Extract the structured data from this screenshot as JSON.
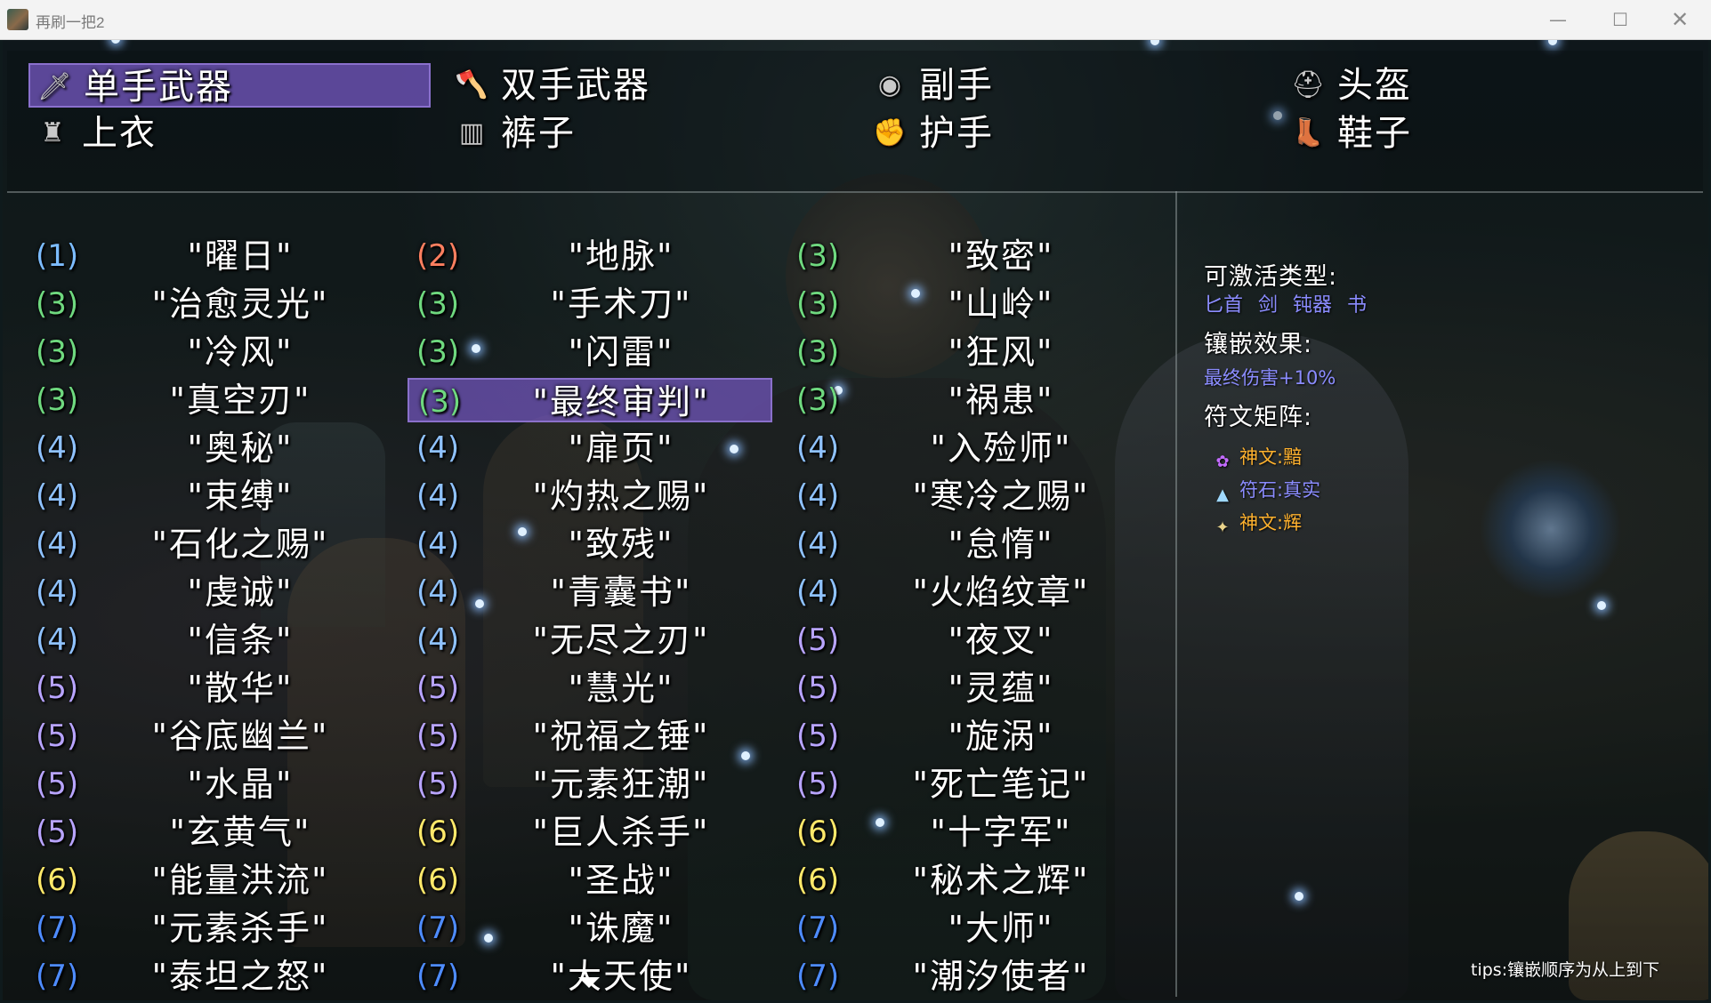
{
  "window": {
    "title": "再刷一把2",
    "minimize": "—",
    "maximize": "☐",
    "close": "✕"
  },
  "tabs": [
    {
      "label": "单手武器",
      "icon": "sword-icon",
      "selected": true
    },
    {
      "label": "双手武器",
      "icon": "axe-icon",
      "selected": false
    },
    {
      "label": "副手",
      "icon": "shield-icon",
      "selected": false
    },
    {
      "label": "头盔",
      "icon": "helmet-icon",
      "selected": false
    },
    {
      "label": "上衣",
      "icon": "armor-icon",
      "selected": false
    },
    {
      "label": "裤子",
      "icon": "pants-icon",
      "selected": false
    },
    {
      "label": "护手",
      "icon": "gauntlet-icon",
      "selected": false
    },
    {
      "label": "鞋子",
      "icon": "boots-icon",
      "selected": false
    }
  ],
  "runewords": [
    [
      {
        "level": "(1)",
        "name": "\"曜日\""
      },
      {
        "level": "(3)",
        "name": "\"治愈灵光\""
      },
      {
        "level": "(3)",
        "name": "\"冷风\""
      },
      {
        "level": "(3)",
        "name": "\"真空刃\""
      },
      {
        "level": "(4)",
        "name": "\"奥秘\""
      },
      {
        "level": "(4)",
        "name": "\"束缚\""
      },
      {
        "level": "(4)",
        "name": "\"石化之赐\""
      },
      {
        "level": "(4)",
        "name": "\"虔诚\""
      },
      {
        "level": "(4)",
        "name": "\"信条\""
      },
      {
        "level": "(5)",
        "name": "\"散华\""
      },
      {
        "level": "(5)",
        "name": "\"谷底幽兰\""
      },
      {
        "level": "(5)",
        "name": "\"水晶\""
      },
      {
        "level": "(5)",
        "name": "\"玄黄气\""
      },
      {
        "level": "(6)",
        "name": "\"能量洪流\""
      },
      {
        "level": "(7)",
        "name": "\"元素杀手\""
      },
      {
        "level": "(7)",
        "name": "\"泰坦之怒\""
      }
    ],
    [
      {
        "level": "(2)",
        "name": "\"地脉\""
      },
      {
        "level": "(3)",
        "name": "\"手术刀\""
      },
      {
        "level": "(3)",
        "name": "\"闪雷\""
      },
      {
        "level": "(3)",
        "name": "\"最终审判\"",
        "selected": true
      },
      {
        "level": "(4)",
        "name": "\"扉页\""
      },
      {
        "level": "(4)",
        "name": "\"灼热之赐\""
      },
      {
        "level": "(4)",
        "name": "\"致残\""
      },
      {
        "level": "(4)",
        "name": "\"青囊书\""
      },
      {
        "level": "(4)",
        "name": "\"无尽之刃\""
      },
      {
        "level": "(5)",
        "name": "\"慧光\""
      },
      {
        "level": "(5)",
        "name": "\"祝福之锤\""
      },
      {
        "level": "(5)",
        "name": "\"元素狂潮\""
      },
      {
        "level": "(6)",
        "name": "\"巨人杀手\""
      },
      {
        "level": "(6)",
        "name": "\"圣战\""
      },
      {
        "level": "(7)",
        "name": "\"诛魔\""
      },
      {
        "level": "(7)",
        "name": "\"大天使\""
      }
    ],
    [
      {
        "level": "(3)",
        "name": "\"致密\""
      },
      {
        "level": "(3)",
        "name": "\"山岭\""
      },
      {
        "level": "(3)",
        "name": "\"狂风\""
      },
      {
        "level": "(3)",
        "name": "\"祸患\""
      },
      {
        "level": "(4)",
        "name": "\"入殓师\""
      },
      {
        "level": "(4)",
        "name": "\"寒冷之赐\""
      },
      {
        "level": "(4)",
        "name": "\"怠惰\""
      },
      {
        "level": "(4)",
        "name": "\"火焰纹章\""
      },
      {
        "level": "(5)",
        "name": "\"夜叉\""
      },
      {
        "level": "(5)",
        "name": "\"灵蕴\""
      },
      {
        "level": "(5)",
        "name": "\"旋涡\""
      },
      {
        "level": "(5)",
        "name": "\"死亡笔记\""
      },
      {
        "level": "(6)",
        "name": "\"十字军\""
      },
      {
        "level": "(6)",
        "name": "\"秘术之辉\""
      },
      {
        "level": "(7)",
        "name": "\"大师\""
      },
      {
        "level": "(7)",
        "name": "\"潮汐使者\""
      }
    ]
  ],
  "info": {
    "types_heading": "可激活类型:",
    "types": "匕首 剑 钝器 书",
    "effect_heading": "镶嵌效果:",
    "effect": "最终伤害+10%",
    "matrix_heading": "符文矩阵:",
    "runes": [
      {
        "text": "神文:黯",
        "color": "#ffb22e",
        "icon": "purple-rune-icon"
      },
      {
        "text": "符石:真实",
        "color": "#8b8cff",
        "icon": "runestone-icon"
      },
      {
        "text": "神文:辉",
        "color": "#ffb22e",
        "icon": "gold-rune-icon"
      }
    ],
    "tips": "tips:镶嵌顺序为从上到下"
  },
  "colors": {
    "selection": "#7658c4",
    "level_1": "#7cbcff",
    "level_2": "#ff7f5f",
    "level_3": "#6fd97f",
    "level_4": "#8fc2ff",
    "level_5": "#b8a4ff",
    "level_6": "#ffe96a",
    "level_7": "#4e8cff",
    "rune_god": "#ffb22e",
    "runestone": "#8b8cff"
  }
}
